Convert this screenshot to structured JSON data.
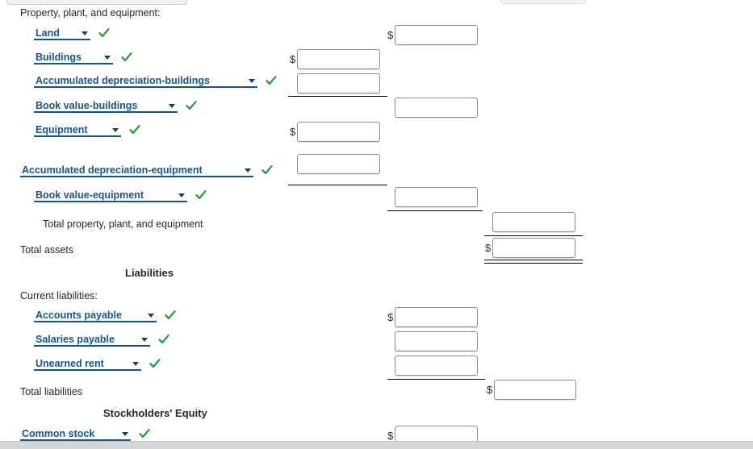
{
  "colors": {
    "select_text": "#14568d",
    "select_underline": "#16558a",
    "check_green": "#1f9c35",
    "label_text": "#262626",
    "field_border": "#8a8a8a"
  },
  "icons": {
    "check": "check-icon",
    "dropdown_arrow": "chevron-down-icon"
  },
  "currency_symbol": "$",
  "sections": {
    "ppe_heading": "Property, plant, and equipment:",
    "liabilities_heading": "Liabilities",
    "current_liabilities_heading": "Current liabilities:",
    "equity_heading": "Stockholders' Equity"
  },
  "totals": {
    "total_ppe": "Total property, plant, and equipment",
    "total_assets": "Total assets",
    "total_liabilities": "Total liabilities"
  },
  "accounts": {
    "land": "Land",
    "buildings": "Buildings",
    "accum_dep_buildings": "Accumulated depreciation-buildings",
    "book_value_buildings": "Book value-buildings",
    "equipment": "Equipment",
    "accum_dep_equipment": "Accumulated depreciation-equipment",
    "book_value_equipment": "Book value-equipment",
    "accounts_payable": "Accounts payable",
    "salaries_payable": "Salaries payable",
    "unearned_rent": "Unearned rent",
    "common_stock": "Common stock"
  },
  "inputs": {
    "land_amount": "",
    "buildings_amount": "",
    "accum_dep_buildings_amount": "",
    "book_value_buildings_amount": "",
    "equipment_amount": "",
    "accum_dep_equipment_amount": "",
    "book_value_equipment_amount": "",
    "total_ppe_amount": "",
    "total_assets_amount": "",
    "accounts_payable_amount": "",
    "salaries_payable_amount": "",
    "unearned_rent_amount": "",
    "total_liabilities_amount": "",
    "common_stock_amount": ""
  },
  "placeholders": {
    "amount": ""
  }
}
